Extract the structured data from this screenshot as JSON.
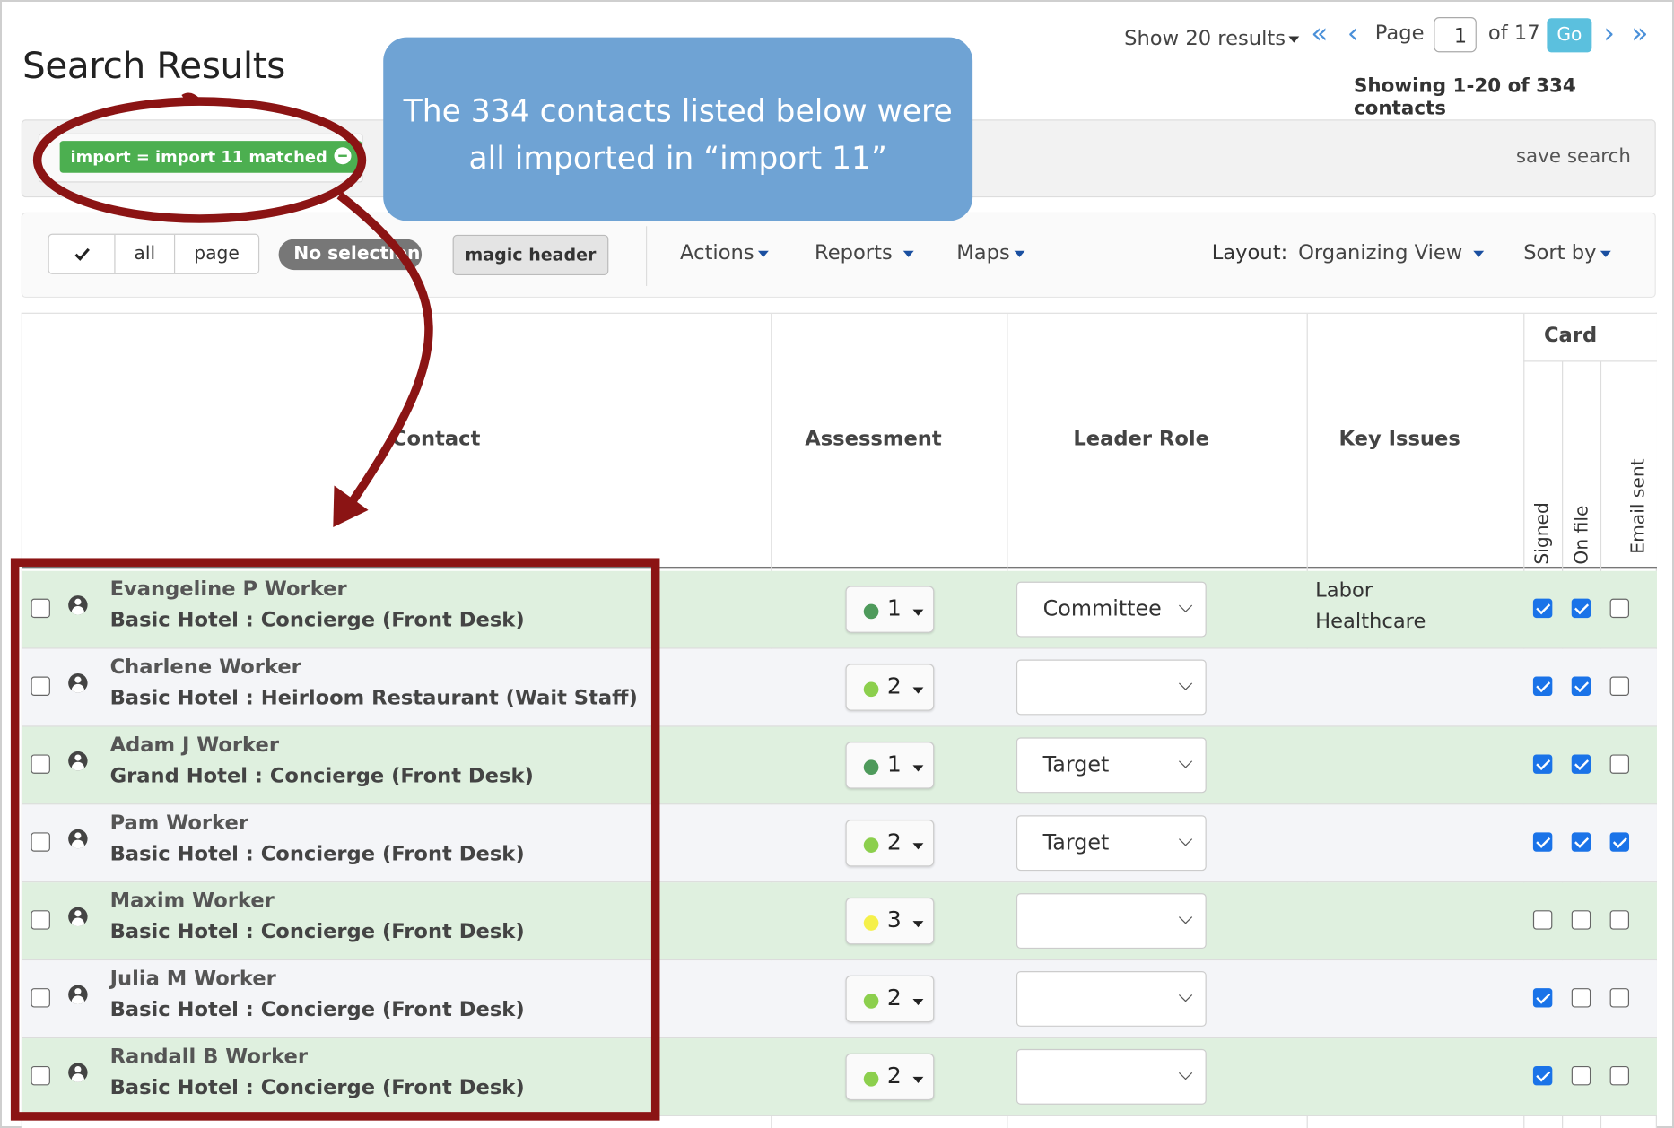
{
  "page": {
    "title": "Search Results"
  },
  "pagination": {
    "show_label": "Show 20 results",
    "page_label": "Page",
    "current_page": "1",
    "of_label": "of 17",
    "go_label": "Go",
    "showing_label": "Showing 1-20 of 334 contacts"
  },
  "filter": {
    "tag_label": "import = import 11 matched",
    "save_label": "save search"
  },
  "toolbar": {
    "check_icon": "check-icon",
    "all_label": "all",
    "page_label": "page",
    "no_selection_label": "No selection",
    "magic_header_label": "magic header",
    "actions_label": "Actions",
    "reports_label": "Reports",
    "maps_label": "Maps",
    "layout_label": "Layout:",
    "layout_value": "Organizing View",
    "sort_label": "Sort by"
  },
  "table": {
    "headers": {
      "contact": "Contact",
      "assessment": "Assessment",
      "leader_role": "Leader Role",
      "key_issues": "Key Issues",
      "card": "Card",
      "signed": "Signed",
      "on_file": "On file",
      "email_sent": "Email sent"
    },
    "rows": [
      {
        "name": "Evangeline P Worker",
        "detail": "Basic Hotel : Concierge (Front Desk)",
        "assessment": "1",
        "leader_role": "Committee",
        "key_issues": [
          "Labor",
          "Healthcare"
        ],
        "signed": true,
        "on_file": true,
        "email_sent": false
      },
      {
        "name": "Charlene Worker",
        "detail": "Basic Hotel : Heirloom Restaurant (Wait Staff)",
        "assessment": "2",
        "leader_role": "",
        "key_issues": [],
        "signed": true,
        "on_file": true,
        "email_sent": false
      },
      {
        "name": "Adam J Worker",
        "detail": "Grand Hotel : Concierge (Front Desk)",
        "assessment": "1",
        "leader_role": "Target",
        "key_issues": [],
        "signed": true,
        "on_file": true,
        "email_sent": false
      },
      {
        "name": "Pam Worker",
        "detail": "Basic Hotel : Concierge (Front Desk)",
        "assessment": "2",
        "leader_role": "Target",
        "key_issues": [],
        "signed": true,
        "on_file": true,
        "email_sent": true
      },
      {
        "name": "Maxim Worker",
        "detail": "Basic Hotel : Concierge (Front Desk)",
        "assessment": "3",
        "leader_role": "",
        "key_issues": [],
        "signed": false,
        "on_file": false,
        "email_sent": false
      },
      {
        "name": "Julia M Worker",
        "detail": "Basic Hotel : Concierge (Front Desk)",
        "assessment": "2",
        "leader_role": "",
        "key_issues": [],
        "signed": true,
        "on_file": false,
        "email_sent": false
      },
      {
        "name": "Randall B Worker",
        "detail": "Basic Hotel : Concierge (Front Desk)",
        "assessment": "2",
        "leader_role": "",
        "key_issues": [],
        "signed": true,
        "on_file": false,
        "email_sent": false
      }
    ]
  },
  "annotation": {
    "callout_line1": "The 334 contacts listed below were",
    "callout_line2": "all imported in “import 11”"
  },
  "colors": {
    "assessment_1": "#4e9a5b",
    "assessment_2": "#8ccf4d",
    "assessment_3": "#f5f04a",
    "row_green": "#dff0df",
    "row_gray": "#f4f5f8",
    "annotation_red": "#8b1414",
    "callout_blue": "#6fa3d4",
    "tag_green": "#4caf50",
    "go_button": "#5bc0de",
    "link_blue": "#4a90d9"
  }
}
